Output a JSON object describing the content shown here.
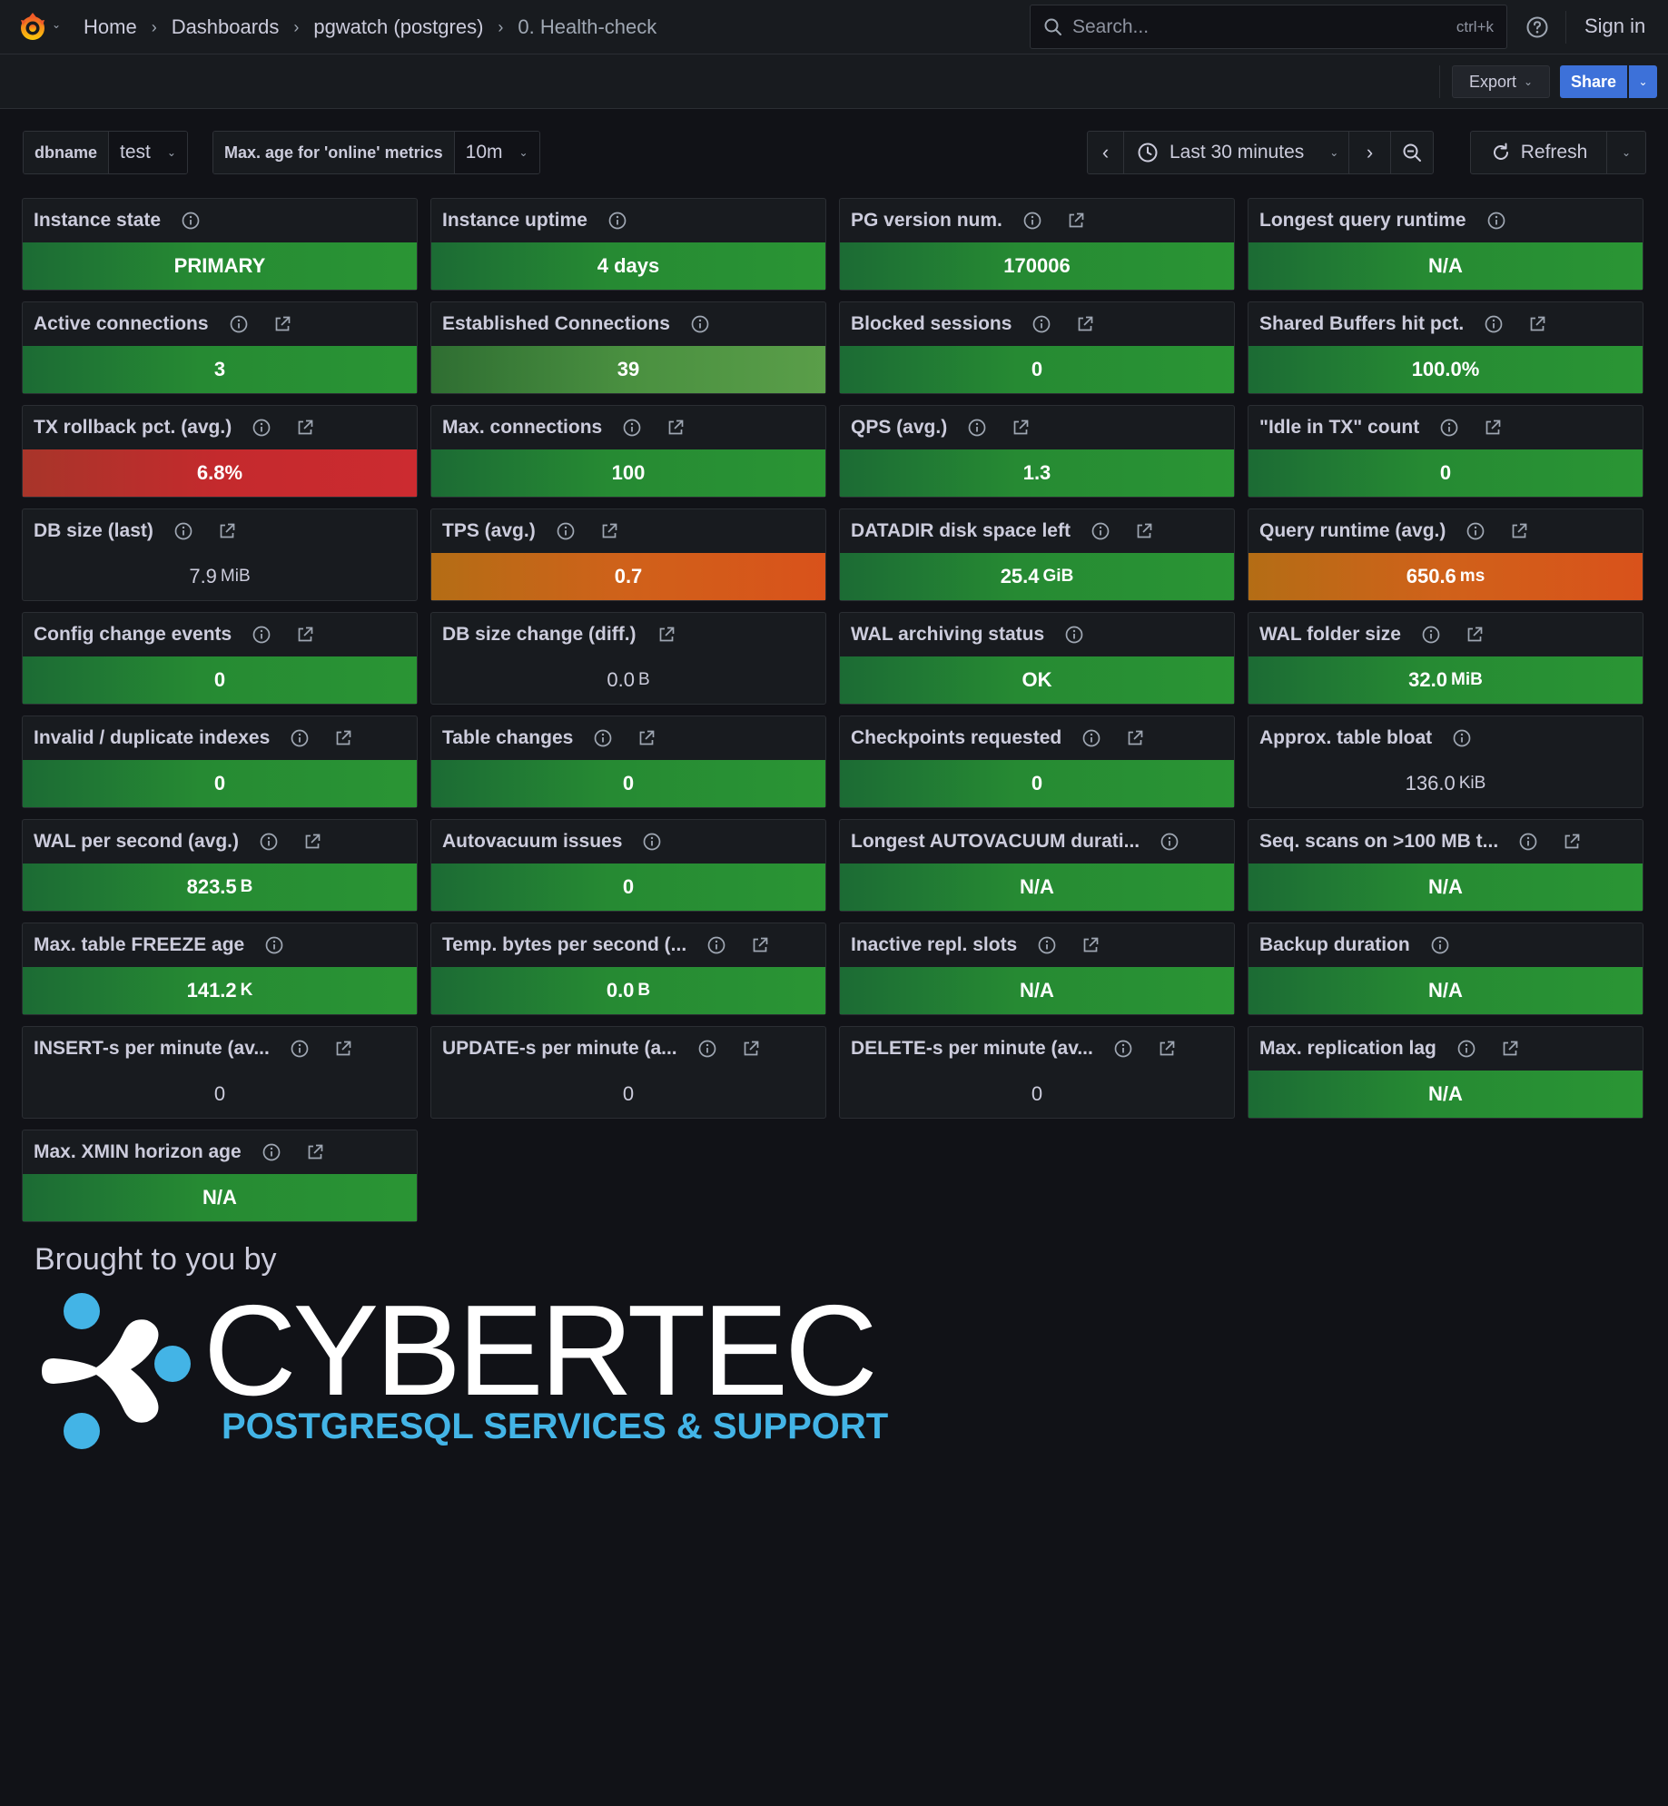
{
  "nav": {
    "breadcrumb": [
      "Home",
      "Dashboards",
      "pgwatch (postgres)",
      "0. Health-check"
    ],
    "search_placeholder": "Search...",
    "search_shortcut": "ctrl+k",
    "sign_in": "Sign in"
  },
  "toolbar": {
    "export_label": "Export",
    "share_label": "Share"
  },
  "variables": [
    {
      "label": "dbname",
      "value": "test"
    },
    {
      "label": "Max. age for 'online' metrics",
      "value": "10m"
    }
  ],
  "time": {
    "range": "Last 30 minutes",
    "refresh_label": "Refresh"
  },
  "colors": {
    "green": "#1a7f37",
    "green_bright": "#37872d",
    "light_green": "#56a64b",
    "red": "#c4162a",
    "orange": "#e0752d",
    "panel_bg": "#181b1f",
    "brand_blue": "#43b4e6"
  },
  "panels": [
    {
      "title": "Instance state",
      "info": true,
      "link": false,
      "value": "PRIMARY",
      "unit": "",
      "status": "green"
    },
    {
      "title": "Instance uptime",
      "info": true,
      "link": false,
      "value": "4 days",
      "unit": "",
      "status": "green"
    },
    {
      "title": "PG version num.",
      "info": true,
      "link": true,
      "value": "170006",
      "unit": "",
      "status": "green"
    },
    {
      "title": "Longest query runtime",
      "info": true,
      "link": false,
      "value": "N/A",
      "unit": "",
      "status": "green"
    },
    {
      "title": "Active connections",
      "info": true,
      "link": true,
      "value": "3",
      "unit": "",
      "status": "green"
    },
    {
      "title": "Established Connections",
      "info": true,
      "link": false,
      "value": "39",
      "unit": "",
      "status": "light-green"
    },
    {
      "title": "Blocked sessions",
      "info": true,
      "link": true,
      "value": "0",
      "unit": "",
      "status": "green"
    },
    {
      "title": "Shared Buffers hit pct.",
      "info": true,
      "link": true,
      "value": "100.0%",
      "unit": "",
      "status": "green"
    },
    {
      "title": "TX rollback pct. (avg.)",
      "info": true,
      "link": true,
      "value": "6.8%",
      "unit": "",
      "status": "red"
    },
    {
      "title": "Max. connections",
      "info": true,
      "link": true,
      "value": "100",
      "unit": "",
      "status": "green"
    },
    {
      "title": "QPS (avg.)",
      "info": true,
      "link": true,
      "value": "1.3",
      "unit": "",
      "status": "green"
    },
    {
      "title": "\"Idle in TX\" count",
      "info": true,
      "link": true,
      "value": "0",
      "unit": "",
      "status": "green"
    },
    {
      "title": "DB size (last)",
      "info": true,
      "link": true,
      "value": "7.9",
      "unit": "MiB",
      "status": "none"
    },
    {
      "title": "TPS (avg.)",
      "info": true,
      "link": true,
      "value": "0.7",
      "unit": "",
      "status": "orange"
    },
    {
      "title": "DATADIR disk space left",
      "info": true,
      "link": true,
      "value": "25.4",
      "unit": "GiB",
      "status": "green"
    },
    {
      "title": "Query runtime (avg.)",
      "info": true,
      "link": true,
      "value": "650.6",
      "unit": "ms",
      "status": "orange"
    },
    {
      "title": "Config change events",
      "info": true,
      "link": true,
      "value": "0",
      "unit": "",
      "status": "green"
    },
    {
      "title": "DB size change (diff.)",
      "info": false,
      "link": true,
      "value": "0.0",
      "unit": "B",
      "status": "none"
    },
    {
      "title": "WAL archiving status",
      "info": true,
      "link": false,
      "value": "OK",
      "unit": "",
      "status": "green"
    },
    {
      "title": "WAL folder size",
      "info": true,
      "link": true,
      "value": "32.0",
      "unit": "MiB",
      "status": "green"
    },
    {
      "title": "Invalid / duplicate indexes",
      "info": true,
      "link": true,
      "value": "0",
      "unit": "",
      "status": "green"
    },
    {
      "title": "Table changes",
      "info": true,
      "link": true,
      "value": "0",
      "unit": "",
      "status": "green"
    },
    {
      "title": "Checkpoints requested",
      "info": true,
      "link": true,
      "value": "0",
      "unit": "",
      "status": "green"
    },
    {
      "title": "Approx. table bloat",
      "info": true,
      "link": false,
      "value": "136.0",
      "unit": "KiB",
      "status": "none"
    },
    {
      "title": "WAL per second (avg.)",
      "info": true,
      "link": true,
      "value": "823.5",
      "unit": "B",
      "status": "green"
    },
    {
      "title": "Autovacuum issues",
      "info": true,
      "link": false,
      "value": "0",
      "unit": "",
      "status": "green"
    },
    {
      "title": "Longest AUTOVACUUM durati...",
      "info": true,
      "link": false,
      "value": "N/A",
      "unit": "",
      "status": "green"
    },
    {
      "title": "Seq. scans on >100 MB t...",
      "info": true,
      "link": true,
      "value": "N/A",
      "unit": "",
      "status": "green"
    },
    {
      "title": "Max. table FREEZE age",
      "info": true,
      "link": false,
      "value": "141.2",
      "unit": "K",
      "status": "green"
    },
    {
      "title": "Temp. bytes per second (...",
      "info": true,
      "link": true,
      "value": "0.0",
      "unit": "B",
      "status": "green"
    },
    {
      "title": "Inactive repl. slots",
      "info": true,
      "link": true,
      "value": "N/A",
      "unit": "",
      "status": "green"
    },
    {
      "title": "Backup duration",
      "info": true,
      "link": false,
      "value": "N/A",
      "unit": "",
      "status": "green"
    },
    {
      "title": "INSERT-s per minute (av...",
      "info": true,
      "link": true,
      "value": "0",
      "unit": "",
      "status": "none"
    },
    {
      "title": "UPDATE-s per minute (a...",
      "info": true,
      "link": true,
      "value": "0",
      "unit": "",
      "status": "none"
    },
    {
      "title": "DELETE-s per minute (av...",
      "info": true,
      "link": true,
      "value": "0",
      "unit": "",
      "status": "none"
    },
    {
      "title": "Max. replication lag",
      "info": true,
      "link": true,
      "value": "N/A",
      "unit": "",
      "status": "green"
    },
    {
      "title": "Max. XMIN horizon age",
      "info": true,
      "link": true,
      "value": "N/A",
      "unit": "",
      "status": "green"
    }
  ],
  "footer": {
    "brought": "Brought to you by",
    "brand": "CYBERTEC",
    "tagline": "POSTGRESQL SERVICES & SUPPORT"
  }
}
